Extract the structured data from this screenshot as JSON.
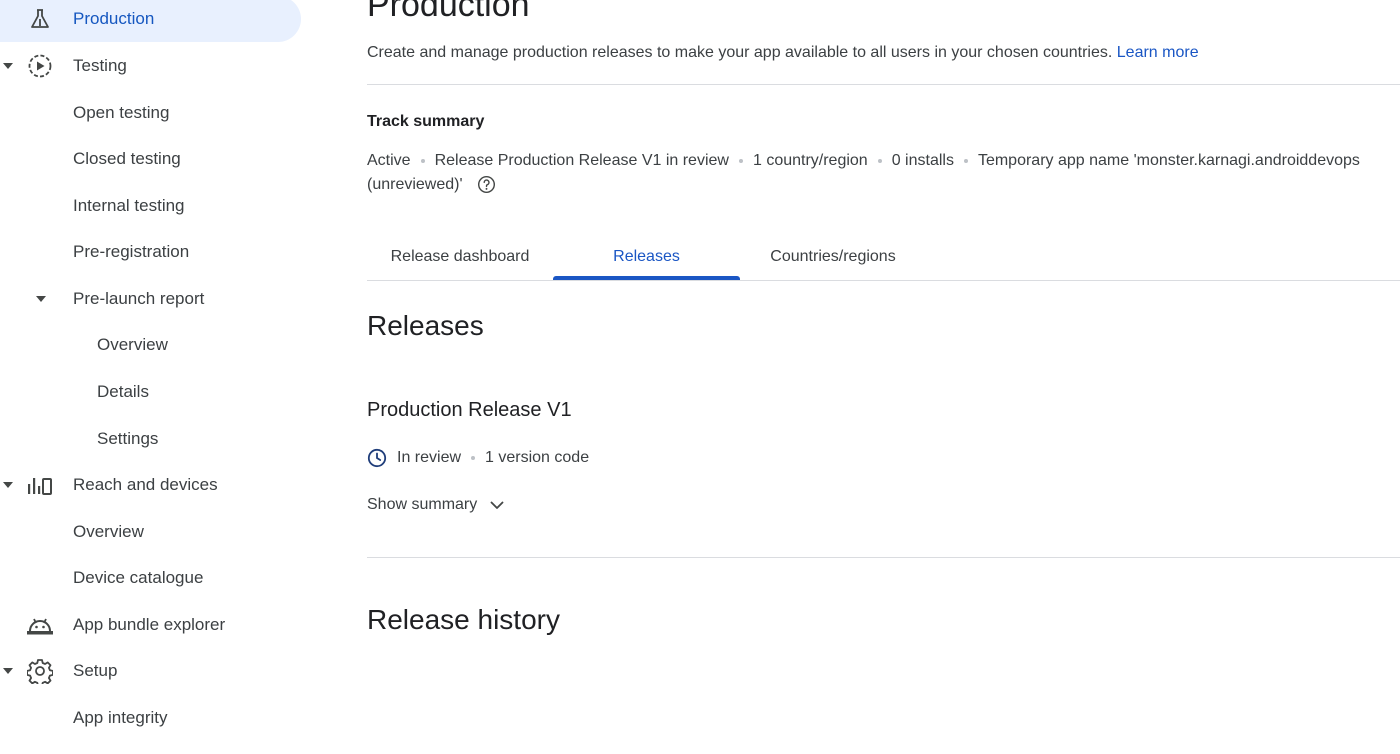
{
  "sidebar": {
    "production": "Production",
    "testing": "Testing",
    "open_testing": "Open testing",
    "closed_testing": "Closed testing",
    "internal_testing": "Internal testing",
    "pre_registration": "Pre-registration",
    "pre_launch_report": "Pre-launch report",
    "overview": "Overview",
    "details": "Details",
    "settings": "Settings",
    "reach_and_devices": "Reach and devices",
    "reach_overview": "Overview",
    "device_catalogue": "Device catalogue",
    "app_bundle_explorer": "App bundle explorer",
    "setup": "Setup",
    "app_integrity": "App integrity"
  },
  "header": {
    "title": "Production",
    "description": "Create and manage production releases to make your app available to all users in your chosen countries.",
    "learn_more": "Learn more"
  },
  "track_summary": {
    "label": "Track summary",
    "status": "Active",
    "release": "Release Production Release V1 in review",
    "countries": "1 country/region",
    "installs": "0 installs",
    "app_name": "Temporary app name 'monster.karnagi.androiddevops",
    "app_name_cont": "(unreviewed)'"
  },
  "tabs": {
    "release_dashboard": "Release dashboard",
    "releases": "Releases",
    "countries": "Countries/regions"
  },
  "releases": {
    "heading": "Releases",
    "release_name": "Production Release V1",
    "status": "In review",
    "version_codes": "1 version code",
    "show_summary": "Show summary"
  },
  "history": {
    "heading": "Release history"
  },
  "colors": {
    "accent": "#1a56c4",
    "active_bg": "#e8f0fe",
    "divider": "#dadce0"
  }
}
